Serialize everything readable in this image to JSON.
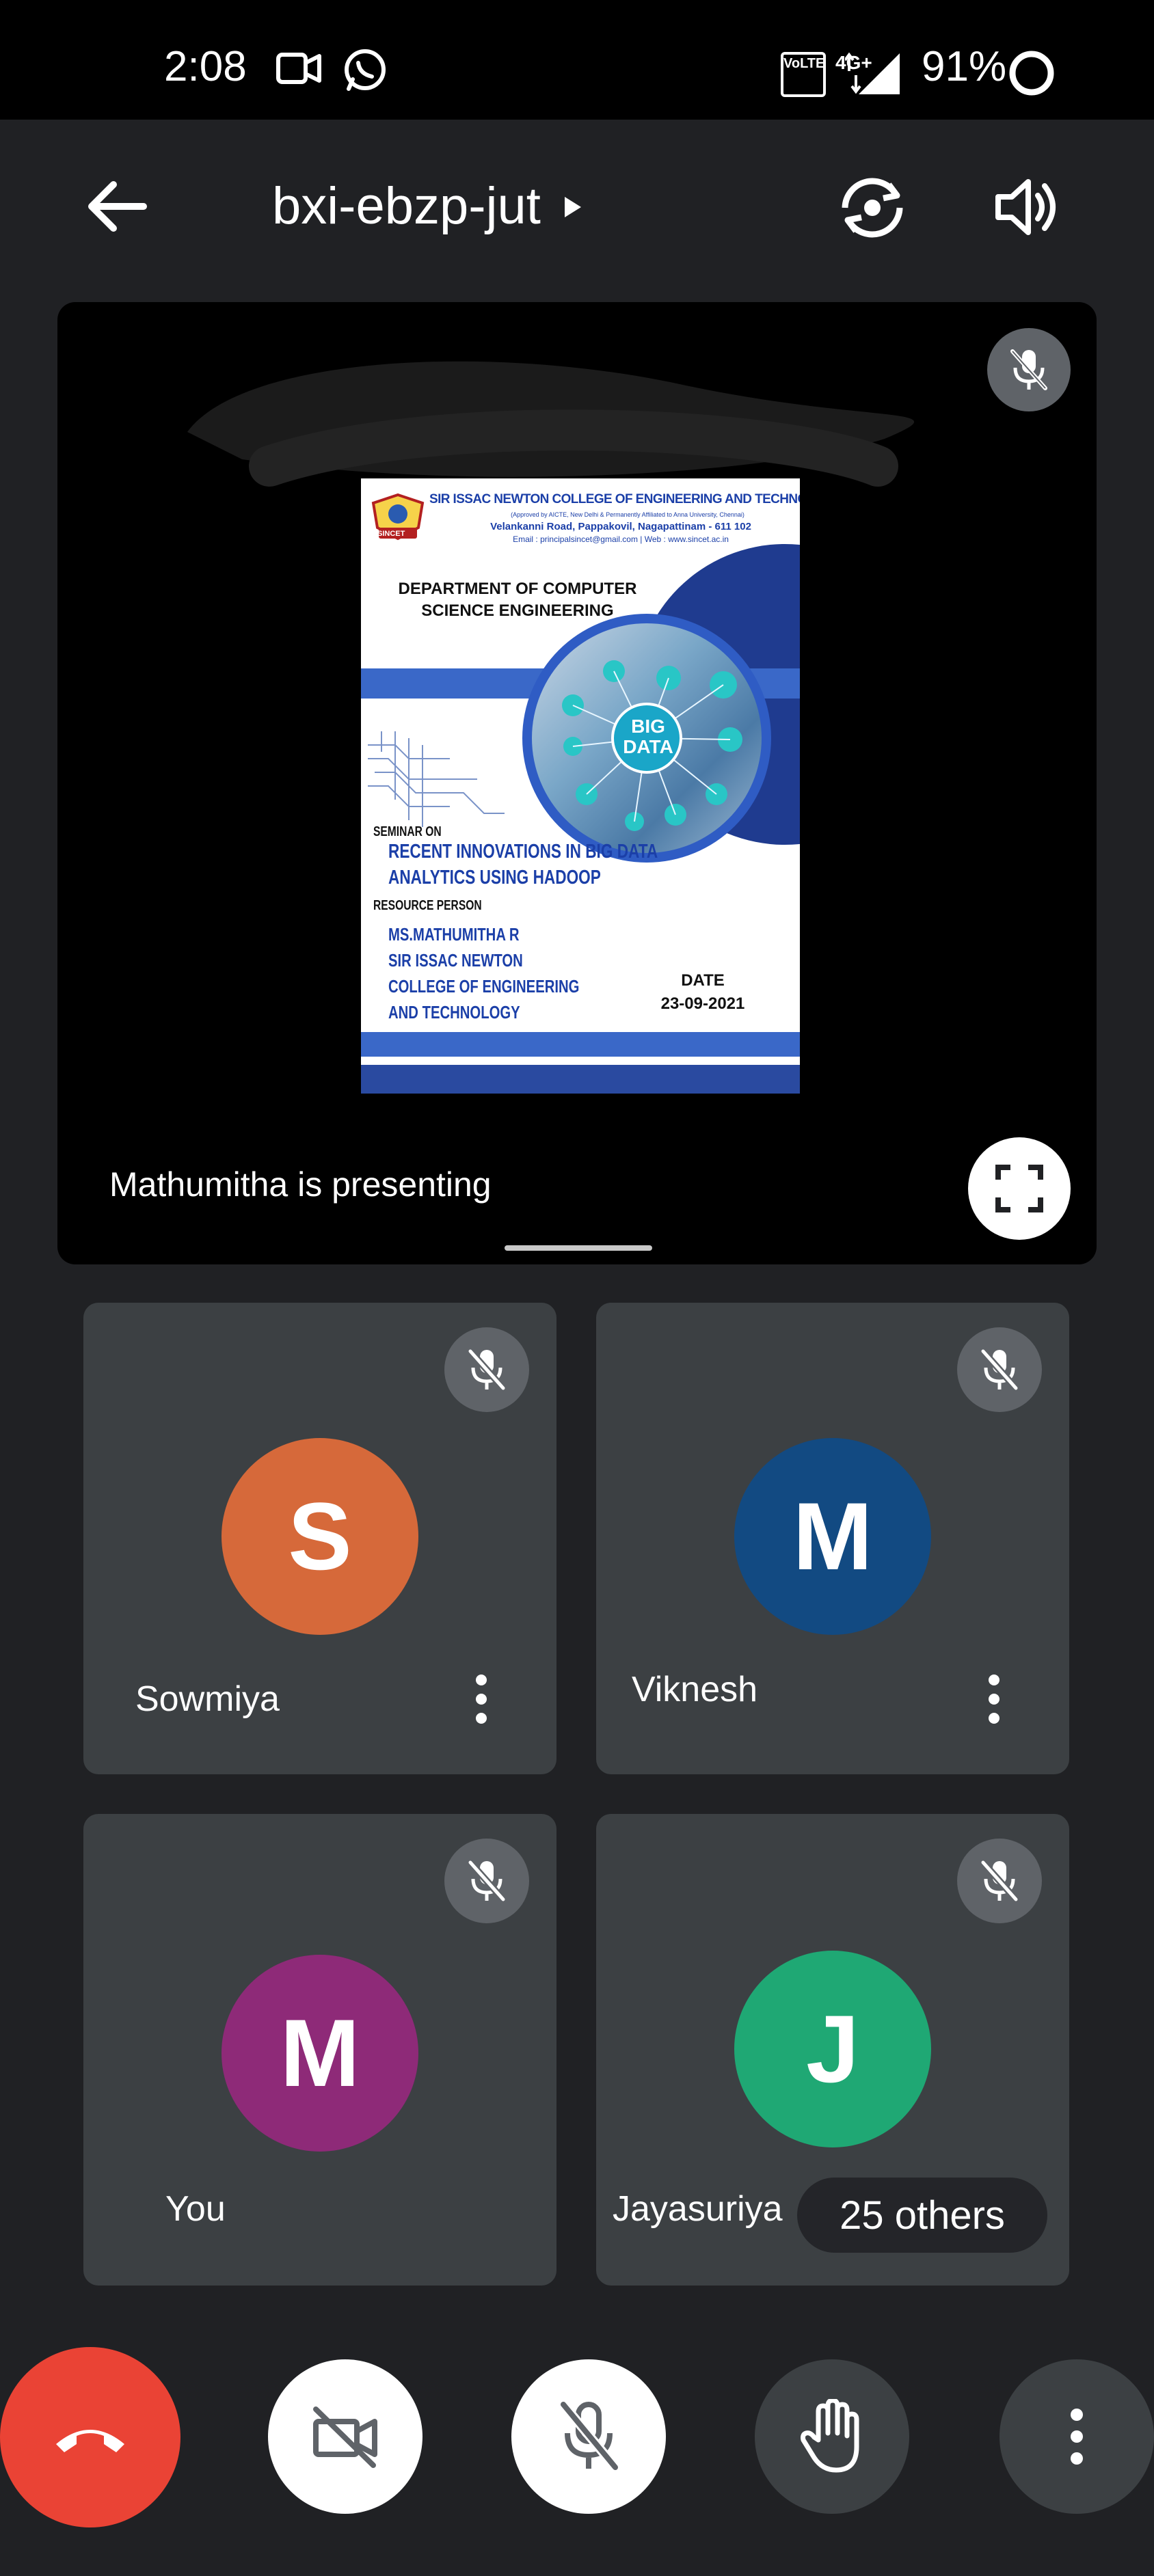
{
  "status_bar": {
    "time": "2:08",
    "battery": "91%",
    "network": "4G+",
    "volte": "VoLTE"
  },
  "top_bar": {
    "meeting_code": "bxi-ebzp-jut",
    "back_icon": "back-arrow-icon",
    "switch_camera_icon": "switch-camera-icon",
    "speaker_icon": "speaker-icon"
  },
  "presentation": {
    "presenting_label": "Mathumitha is presenting",
    "poster": {
      "college_name": "SIR ISSAC NEWTON COLLEGE OF ENGINEERING AND TECHNOLOGY",
      "approval": "(Approved by AICTE, New Delhi & Permanently Affiliated to Anna University, Chennai)",
      "address": "Velankanni Road, Pappakovil, Nagapattinam - 611 102",
      "contact": "Email : principalsincet@gmail.com | Web : www.sincet.ac.in",
      "logo_text": "SINCET",
      "department": "DEPARTMENT OF COMPUTER SCIENCE ENGINEERING",
      "big_data_line1": "BIG",
      "big_data_line2": "DATA",
      "seminar_on": "SEMINAR ON",
      "topic_line1": "RECENT INNOVATIONS IN BIG DATA",
      "topic_line2": "ANALYTICS USING HADOOP",
      "resource_person": "RESOURCE PERSON",
      "person_line1": "MS.MATHUMITHA R",
      "person_line2": "SIR ISSAC NEWTON",
      "person_line3": "COLLEGE OF ENGINEERING",
      "person_line4": "AND TECHNOLOGY",
      "date_label": "DATE",
      "date_value": "23-09-2021"
    }
  },
  "participants": [
    {
      "name": "Sowmiya",
      "initial": "S",
      "color": "#d6693a",
      "muted": true
    },
    {
      "name": "Viknesh",
      "initial": "M",
      "color": "#124a82",
      "muted": true
    },
    {
      "name": "You",
      "initial": "M",
      "color": "#8e2a78",
      "muted": true
    },
    {
      "name": "Jayasuriya",
      "initial": "J",
      "color": "#1fa874",
      "muted": true
    }
  ],
  "others": "25 others",
  "controls": {
    "end_call_color": "#ea4335",
    "camera_state": "off",
    "mic_state": "off"
  }
}
